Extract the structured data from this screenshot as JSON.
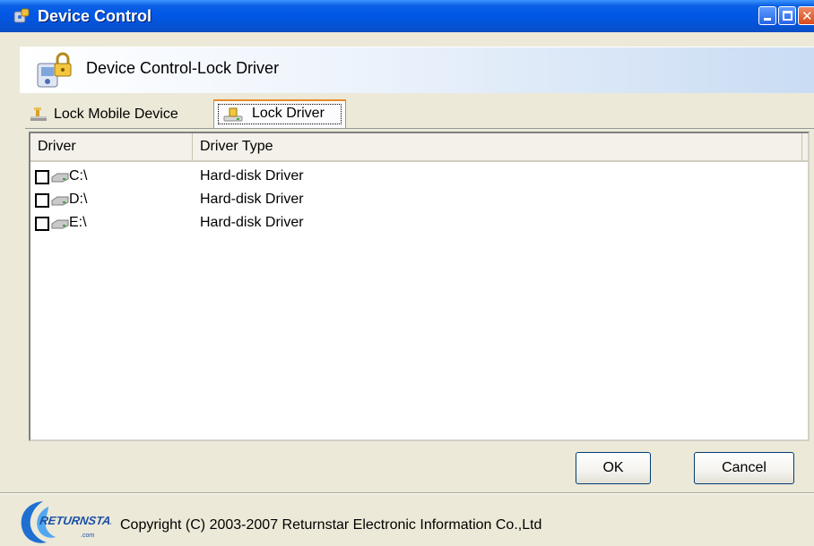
{
  "window": {
    "title": "Device Control"
  },
  "header": {
    "title": "Device Control-Lock Driver"
  },
  "tabs": [
    {
      "label": "Lock Mobile Device",
      "icon": "usb-lock-icon",
      "selected": false
    },
    {
      "label": "Lock Driver",
      "icon": "drive-lock-icon",
      "selected": true
    }
  ],
  "list": {
    "columns": [
      "Driver",
      "Driver Type"
    ],
    "rows": [
      {
        "name": "C:\\",
        "type": "Hard-disk Driver",
        "checked": false
      },
      {
        "name": "D:\\",
        "type": "Hard-disk Driver",
        "checked": false
      },
      {
        "name": "E:\\",
        "type": "Hard-disk Driver",
        "checked": false
      }
    ]
  },
  "buttons": {
    "ok": "OK",
    "cancel": "Cancel"
  },
  "footer": {
    "logo_text": "RETURNSTAR",
    "logo_subtext": ".com",
    "copyright": "Copyright (C) 2003-2007 Returnstar Electronic Information Co.,Ltd"
  },
  "colors": {
    "titlebar": "#0058e6",
    "tab_highlight": "#e68b2c",
    "logo_blue": "#1a4fa3"
  }
}
